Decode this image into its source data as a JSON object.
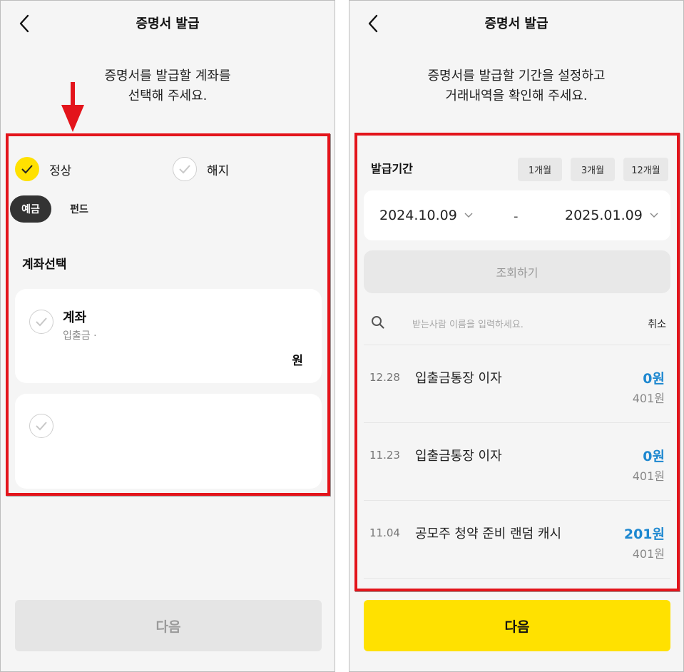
{
  "left": {
    "header_title": "증명서 발급",
    "guide": [
      "증명서를 발급할 계좌를",
      "선택해 주세요."
    ],
    "status_options": [
      {
        "label": "정상",
        "selected": true
      },
      {
        "label": "해지",
        "selected": false
      }
    ],
    "type_tabs": [
      {
        "label": "예금",
        "active": true
      },
      {
        "label": "펀드",
        "active": false
      }
    ],
    "section_title": "계좌선택",
    "account_card": {
      "name": "계좌",
      "sub": "입출금 ·",
      "balance": "원"
    },
    "next_label": "다음"
  },
  "right": {
    "header_title": "증명서 발급",
    "guide": [
      "증명서를 발급할 기간을 설정하고",
      "거래내역을 확인해 주세요."
    ],
    "period_label": "발급기간",
    "period_chips": [
      "1개월",
      "3개월",
      "12개월"
    ],
    "start_date": "2024.10.09",
    "end_date": "2025.01.09",
    "date_separator": "-",
    "query_label": "조회하기",
    "search_placeholder": "받는사람 이름을 입력하세요.",
    "cancel_label": "취소",
    "transactions": [
      {
        "date": "12.28",
        "desc": "입출금통장 이자",
        "amount": "0원",
        "balance": "401원"
      },
      {
        "date": "11.23",
        "desc": "입출금통장 이자",
        "amount": "0원",
        "balance": "401원"
      },
      {
        "date": "11.04",
        "desc": "공모주 청약 준비 랜덤 캐시",
        "amount": "201원",
        "balance": "401원"
      }
    ],
    "next_label": "다음"
  },
  "colors": {
    "highlight_red": "#e3141b",
    "accent_yellow": "#ffe100",
    "amount_blue": "#1e88d0"
  }
}
